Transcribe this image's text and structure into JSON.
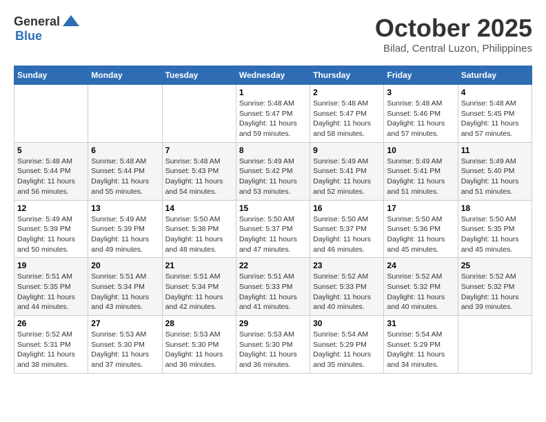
{
  "logo": {
    "general": "General",
    "blue": "Blue"
  },
  "title": "October 2025",
  "location": "Bilad, Central Luzon, Philippines",
  "days_of_week": [
    "Sunday",
    "Monday",
    "Tuesday",
    "Wednesday",
    "Thursday",
    "Friday",
    "Saturday"
  ],
  "weeks": [
    [
      {
        "day": null,
        "info": null
      },
      {
        "day": null,
        "info": null
      },
      {
        "day": null,
        "info": null
      },
      {
        "day": "1",
        "sunrise": "5:48 AM",
        "sunset": "5:47 PM",
        "daylight": "11 hours and 59 minutes."
      },
      {
        "day": "2",
        "sunrise": "5:48 AM",
        "sunset": "5:47 PM",
        "daylight": "11 hours and 58 minutes."
      },
      {
        "day": "3",
        "sunrise": "5:48 AM",
        "sunset": "5:46 PM",
        "daylight": "11 hours and 57 minutes."
      },
      {
        "day": "4",
        "sunrise": "5:48 AM",
        "sunset": "5:45 PM",
        "daylight": "11 hours and 57 minutes."
      }
    ],
    [
      {
        "day": "5",
        "sunrise": "5:48 AM",
        "sunset": "5:44 PM",
        "daylight": "11 hours and 56 minutes."
      },
      {
        "day": "6",
        "sunrise": "5:48 AM",
        "sunset": "5:44 PM",
        "daylight": "11 hours and 55 minutes."
      },
      {
        "day": "7",
        "sunrise": "5:48 AM",
        "sunset": "5:43 PM",
        "daylight": "11 hours and 54 minutes."
      },
      {
        "day": "8",
        "sunrise": "5:49 AM",
        "sunset": "5:42 PM",
        "daylight": "11 hours and 53 minutes."
      },
      {
        "day": "9",
        "sunrise": "5:49 AM",
        "sunset": "5:41 PM",
        "daylight": "11 hours and 52 minutes."
      },
      {
        "day": "10",
        "sunrise": "5:49 AM",
        "sunset": "5:41 PM",
        "daylight": "11 hours and 51 minutes."
      },
      {
        "day": "11",
        "sunrise": "5:49 AM",
        "sunset": "5:40 PM",
        "daylight": "11 hours and 51 minutes."
      }
    ],
    [
      {
        "day": "12",
        "sunrise": "5:49 AM",
        "sunset": "5:39 PM",
        "daylight": "11 hours and 50 minutes."
      },
      {
        "day": "13",
        "sunrise": "5:49 AM",
        "sunset": "5:39 PM",
        "daylight": "11 hours and 49 minutes."
      },
      {
        "day": "14",
        "sunrise": "5:50 AM",
        "sunset": "5:38 PM",
        "daylight": "11 hours and 48 minutes."
      },
      {
        "day": "15",
        "sunrise": "5:50 AM",
        "sunset": "5:37 PM",
        "daylight": "11 hours and 47 minutes."
      },
      {
        "day": "16",
        "sunrise": "5:50 AM",
        "sunset": "5:37 PM",
        "daylight": "11 hours and 46 minutes."
      },
      {
        "day": "17",
        "sunrise": "5:50 AM",
        "sunset": "5:36 PM",
        "daylight": "11 hours and 45 minutes."
      },
      {
        "day": "18",
        "sunrise": "5:50 AM",
        "sunset": "5:35 PM",
        "daylight": "11 hours and 45 minutes."
      }
    ],
    [
      {
        "day": "19",
        "sunrise": "5:51 AM",
        "sunset": "5:35 PM",
        "daylight": "11 hours and 44 minutes."
      },
      {
        "day": "20",
        "sunrise": "5:51 AM",
        "sunset": "5:34 PM",
        "daylight": "11 hours and 43 minutes."
      },
      {
        "day": "21",
        "sunrise": "5:51 AM",
        "sunset": "5:34 PM",
        "daylight": "11 hours and 42 minutes."
      },
      {
        "day": "22",
        "sunrise": "5:51 AM",
        "sunset": "5:33 PM",
        "daylight": "11 hours and 41 minutes."
      },
      {
        "day": "23",
        "sunrise": "5:52 AM",
        "sunset": "5:33 PM",
        "daylight": "11 hours and 40 minutes."
      },
      {
        "day": "24",
        "sunrise": "5:52 AM",
        "sunset": "5:32 PM",
        "daylight": "11 hours and 40 minutes."
      },
      {
        "day": "25",
        "sunrise": "5:52 AM",
        "sunset": "5:32 PM",
        "daylight": "11 hours and 39 minutes."
      }
    ],
    [
      {
        "day": "26",
        "sunrise": "5:52 AM",
        "sunset": "5:31 PM",
        "daylight": "11 hours and 38 minutes."
      },
      {
        "day": "27",
        "sunrise": "5:53 AM",
        "sunset": "5:30 PM",
        "daylight": "11 hours and 37 minutes."
      },
      {
        "day": "28",
        "sunrise": "5:53 AM",
        "sunset": "5:30 PM",
        "daylight": "11 hours and 36 minutes."
      },
      {
        "day": "29",
        "sunrise": "5:53 AM",
        "sunset": "5:30 PM",
        "daylight": "11 hours and 36 minutes."
      },
      {
        "day": "30",
        "sunrise": "5:54 AM",
        "sunset": "5:29 PM",
        "daylight": "11 hours and 35 minutes."
      },
      {
        "day": "31",
        "sunrise": "5:54 AM",
        "sunset": "5:29 PM",
        "daylight": "11 hours and 34 minutes."
      },
      {
        "day": null,
        "info": null
      }
    ]
  ],
  "labels": {
    "sunrise": "Sunrise:",
    "sunset": "Sunset:",
    "daylight": "Daylight:"
  }
}
